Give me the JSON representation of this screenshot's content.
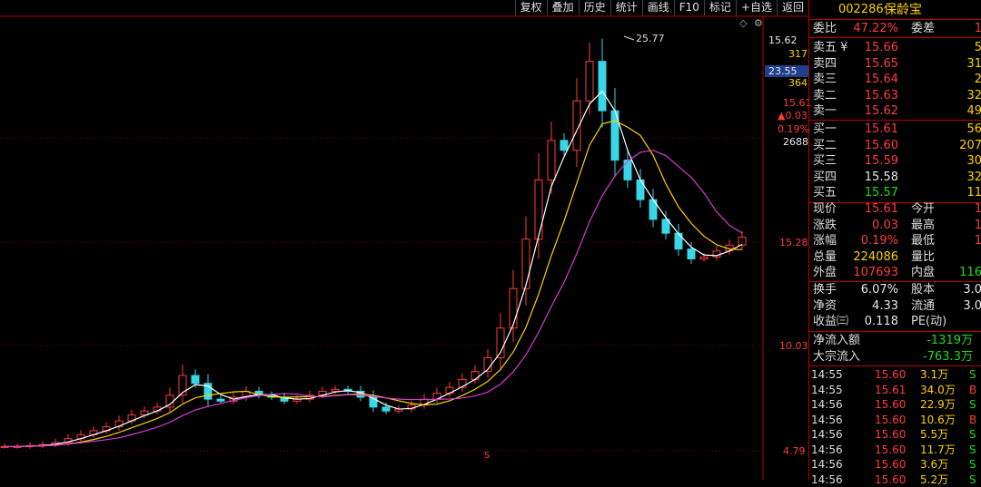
{
  "toolbar": [
    "复权",
    "叠加",
    "历史",
    "统计",
    "画线",
    "F10",
    "标记",
    "+自选",
    "返回"
  ],
  "stock": {
    "code": "002286",
    "name": "保龄宝"
  },
  "axis": {
    "price_ticks": [
      "15.62",
      "317",
      "23.55",
      "364",
      "15.61",
      "▲0.03",
      "0.19%",
      "2688",
      "15.28",
      "10.03",
      "4.79"
    ],
    "peak_label": "25.77",
    "marker": "S"
  },
  "quote_top": {
    "label": "委比",
    "value": "47.22%",
    "label2": "委差",
    "value2": "1"
  },
  "asks": [
    {
      "label": "卖五 ¥",
      "price": "15.66",
      "vol": "5"
    },
    {
      "label": "卖四",
      "price": "15.65",
      "vol": "31"
    },
    {
      "label": "卖三",
      "price": "15.64",
      "vol": "2"
    },
    {
      "label": "卖二",
      "price": "15.63",
      "vol": "32"
    },
    {
      "label": "卖一",
      "price": "15.62",
      "vol": "49"
    }
  ],
  "bids": [
    {
      "label": "买一",
      "price": "15.61",
      "vol": "56"
    },
    {
      "label": "买二",
      "price": "15.60",
      "vol": "207"
    },
    {
      "label": "买三",
      "price": "15.59",
      "vol": "30"
    },
    {
      "label": "买四",
      "price": "15.58",
      "vol": "32"
    },
    {
      "label": "买五",
      "price": "15.57",
      "vol": "11"
    }
  ],
  "stats": [
    {
      "l": "现价",
      "v": "15.61",
      "l2": "今开",
      "v2": "1"
    },
    {
      "l": "涨跌",
      "v": "0.03",
      "l2": "最高",
      "v2": "1"
    },
    {
      "l": "涨幅",
      "v": "0.19%",
      "l2": "最低",
      "v2": "1"
    },
    {
      "l": "总量",
      "v": "224086",
      "l2": "量比",
      "v2": ""
    },
    {
      "l": "外盘",
      "v": "107693",
      "l2": "内盘",
      "v2": "116"
    }
  ],
  "stats2": [
    {
      "l": "换手",
      "v": "6.07%",
      "l2": "股本",
      "v2": "3.0"
    },
    {
      "l": "净资",
      "v": "4.33",
      "l2": "流通",
      "v2": "3.0"
    },
    {
      "l": "收益㈢",
      "v": "0.118",
      "l2": "PE(动)",
      "v2": ""
    }
  ],
  "flows": [
    {
      "l": "净流入额",
      "v": "-1319万"
    },
    {
      "l": "大宗流入",
      "v": "-763.3万"
    }
  ],
  "trades": [
    {
      "t": "14:55",
      "p": "15.60",
      "v": "3.1万",
      "s": "S"
    },
    {
      "t": "14:55",
      "p": "15.61",
      "v": "34.0万",
      "s": "B"
    },
    {
      "t": "14:56",
      "p": "15.60",
      "v": "22.9万",
      "s": "S"
    },
    {
      "t": "14:56",
      "p": "15.60",
      "v": "10.6万",
      "s": "B"
    },
    {
      "t": "14:56",
      "p": "15.60",
      "v": "5.5万",
      "s": "S"
    },
    {
      "t": "14:56",
      "p": "15.60",
      "v": "11.7万",
      "s": "S"
    },
    {
      "t": "14:56",
      "p": "15.60",
      "v": "3.6万",
      "s": "S"
    },
    {
      "t": "14:56",
      "p": "15.60",
      "v": "5.2万",
      "s": "S"
    }
  ],
  "chart_data": {
    "type": "candlestick",
    "price_range": [
      4.79,
      25.77
    ],
    "close_trend": [
      5.0,
      5.0,
      5.05,
      5.1,
      5.2,
      5.4,
      5.6,
      5.8,
      6.0,
      6.3,
      6.6,
      6.8,
      7.0,
      7.6,
      8.6,
      8.2,
      7.4,
      7.3,
      7.5,
      7.8,
      7.6,
      7.5,
      7.3,
      7.4,
      7.6,
      7.8,
      7.9,
      7.8,
      7.5,
      7.0,
      6.8,
      6.9,
      7.1,
      7.4,
      7.7,
      8.0,
      8.4,
      8.8,
      9.5,
      11.0,
      13.0,
      15.5,
      18.5,
      20.5,
      20.0,
      22.5,
      24.5,
      22.0,
      19.5,
      18.5,
      17.5,
      16.5,
      15.8,
      15.0,
      14.5,
      14.6,
      14.9,
      15.2,
      15.6
    ]
  }
}
